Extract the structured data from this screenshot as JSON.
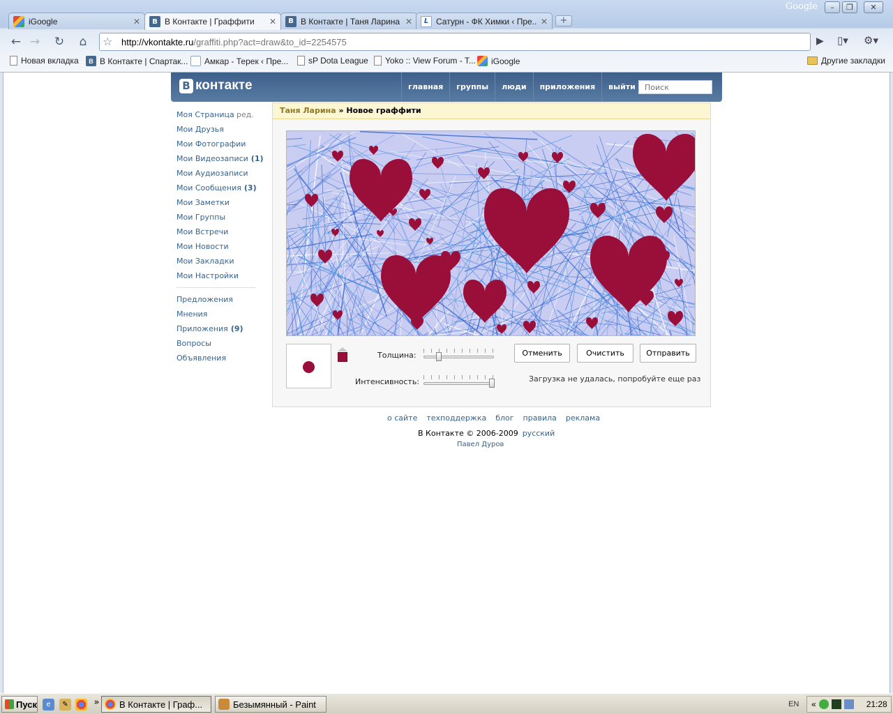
{
  "browser": {
    "brand": "Google",
    "window_controls": [
      "–",
      "❐",
      "✕"
    ],
    "tabs": [
      {
        "title": "iGoogle",
        "favicon": "google"
      },
      {
        "title": "В Контакте | Граффити",
        "favicon": "vk",
        "active": true
      },
      {
        "title": "В Контакте | Таня Ларина",
        "favicon": "vk"
      },
      {
        "title": "Сатурн - ФК Химки ‹ Пре...",
        "favicon": "l"
      }
    ],
    "url_host": "http://vkontakte.ru",
    "url_path": "/graffiti.php?act=draw&to_id=2254575",
    "bookmarks": [
      {
        "label": "Новая вкладка",
        "icon": "doc"
      },
      {
        "label": "В Контакте | Спартак...",
        "icon": "vk"
      },
      {
        "label": "Амкар - Терек ‹ Пре...",
        "icon": "l"
      },
      {
        "label": "sP Dota League",
        "icon": "doc"
      },
      {
        "label": "Yoko :: View Forum - T...",
        "icon": "doc"
      },
      {
        "label": "iGoogle",
        "icon": "google"
      }
    ],
    "other_bookmarks": "Другие закладки"
  },
  "vk": {
    "logo_letter": "В",
    "logo_text": "контакте",
    "nav": [
      "главная",
      "группы",
      "люди",
      "приложения",
      "выйти"
    ],
    "search_placeholder": "Поиск",
    "left_menu": {
      "my_page": "Моя Страница",
      "edit": "ред.",
      "items": [
        {
          "label": "Мои Друзья",
          "count": ""
        },
        {
          "label": "Мои Фотографии",
          "count": ""
        },
        {
          "label": "Мои Видеозаписи",
          "count": "(1)"
        },
        {
          "label": "Мои Аудиозаписи",
          "count": ""
        },
        {
          "label": "Мои Сообщения",
          "count": "(3)"
        },
        {
          "label": "Мои Заметки",
          "count": ""
        },
        {
          "label": "Мои Группы",
          "count": ""
        },
        {
          "label": "Мои Встречи",
          "count": ""
        },
        {
          "label": "Мои Новости",
          "count": ""
        },
        {
          "label": "Мои Закладки",
          "count": ""
        },
        {
          "label": "Мои Настройки",
          "count": ""
        }
      ],
      "extra": [
        {
          "label": "Предложения",
          "count": ""
        },
        {
          "label": "Мнения",
          "count": ""
        },
        {
          "label": "Приложения",
          "count": "(9)"
        },
        {
          "label": "Вопросы",
          "count": ""
        },
        {
          "label": "Объявления",
          "count": ""
        }
      ]
    },
    "breadcrumb": {
      "user": "Таня Ларина",
      "separator": "»",
      "page": "Новое граффити"
    },
    "graffiti": {
      "brush_color": "#9a0f3a",
      "thickness_label": "Толщина:",
      "thickness_value": 0.22,
      "intensity_label": "Интенсивность:",
      "intensity_value": 1.0,
      "buttons": {
        "undo": "Отменить",
        "clear": "Очистить",
        "send": "Отправить"
      },
      "status": "Загрузка не удалась, попробуйте еще раз"
    },
    "footer": {
      "links": [
        "о сайте",
        "техподдержка",
        "блог",
        "правила",
        "реклама"
      ],
      "copyright": "В Контакте © 2006-2009",
      "language": "русский",
      "author": "Павел Дуров"
    }
  },
  "taskbar": {
    "start": "Пуск",
    "tasks": [
      {
        "label": "В Контакте | Граф...",
        "active": true
      },
      {
        "label": "Безымянный - Paint",
        "active": false
      }
    ],
    "lang": "EN",
    "time": "21:28",
    "chevron": "»",
    "tray_chevron": "«"
  }
}
